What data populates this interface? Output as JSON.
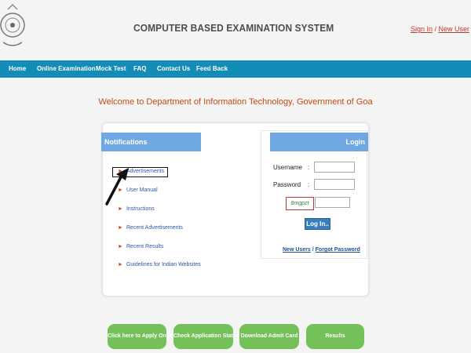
{
  "header": {
    "title": "COMPUTER BASED EXAMINATION SYSTEM",
    "sign_in": "Sign In",
    "separator": " / ",
    "new_user": "New User",
    "logo_icon": "government-emblem-icon"
  },
  "nav": {
    "items": [
      "Home",
      "Online Examination",
      "Mock Test",
      "FAQ",
      "Contact Us",
      "Feed Back"
    ]
  },
  "welcome": "Welcome to Department of Information Technology, Government of Goa",
  "notifications": {
    "title": "Notifications",
    "bullet": "►",
    "items": [
      "Advertisements",
      "User Manual",
      "Instructions",
      "Recent Advertisements",
      "Recent Results",
      "Guidelines for Indian Websites"
    ]
  },
  "login": {
    "title": "Login",
    "username_label": "Username",
    "password_label": "Password",
    "colon": ":",
    "username_value": "",
    "password_value": "",
    "captcha_text": "8mgpzt",
    "captcha_input_value": "",
    "button": "Log In..",
    "new_users": "New Users",
    "forgot": "Forgot Password",
    "link_separator": " / "
  },
  "actions": [
    "Click here to Apply Online",
    "Check Application Status",
    "Download Admit Card",
    "Results"
  ],
  "colors": {
    "nav_bg": "#138cb8",
    "panel_header": "#6fa7e2",
    "welcome_text": "#c44a11",
    "action_button": "#74c15a"
  }
}
